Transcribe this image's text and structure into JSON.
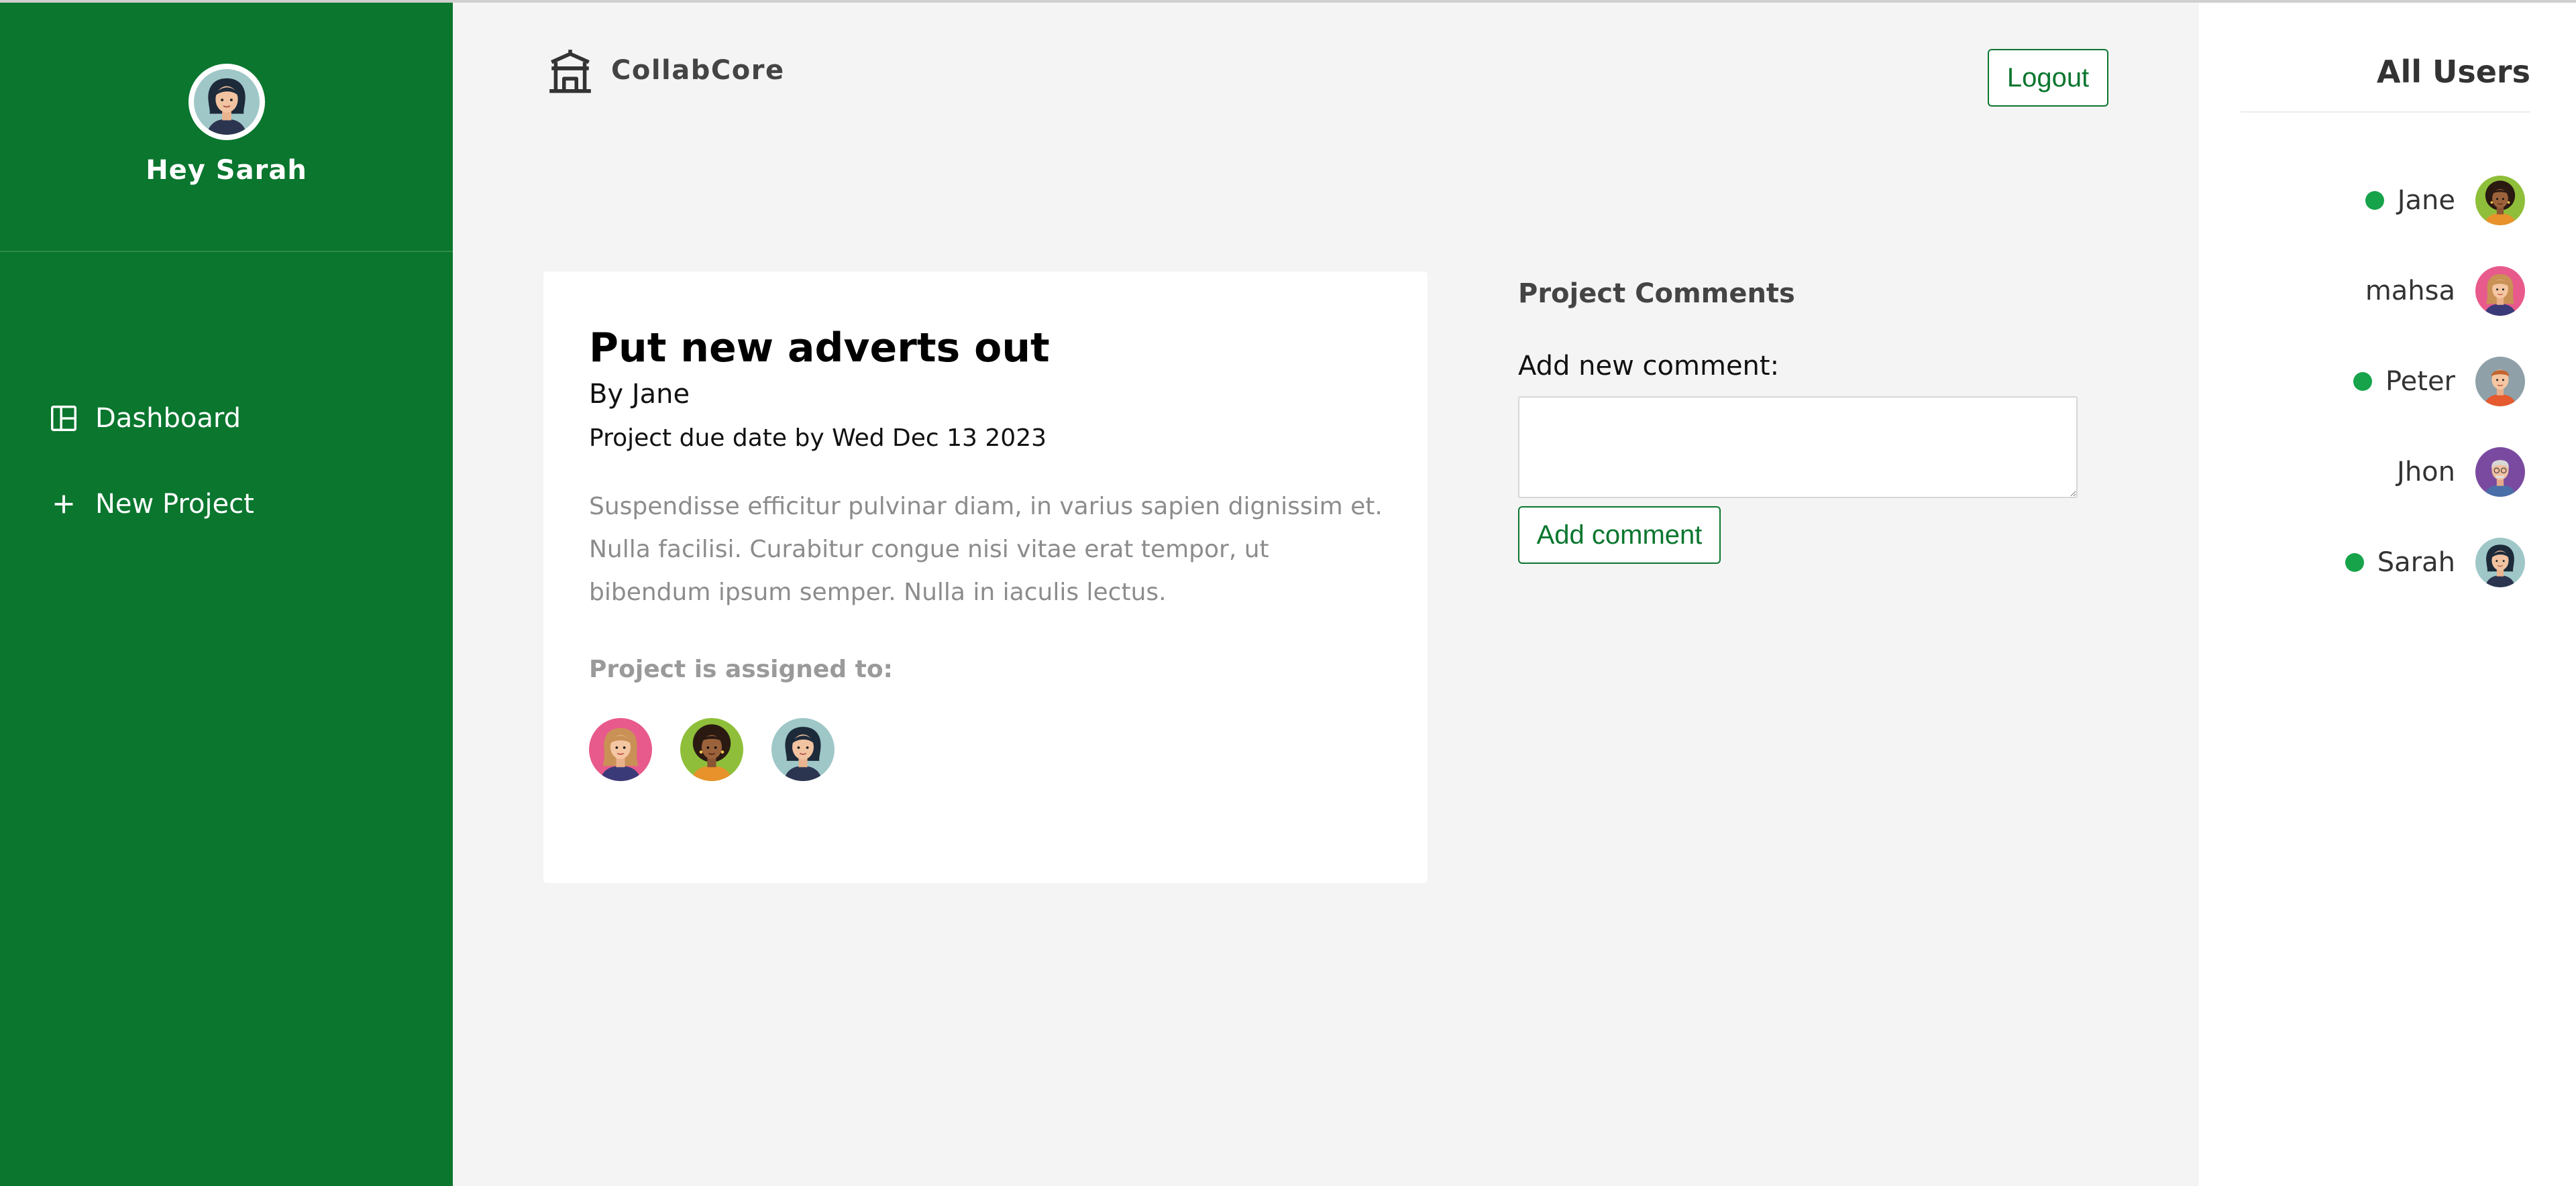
{
  "sidebar": {
    "greeting": "Hey Sarah",
    "nav": [
      {
        "label": "Dashboard",
        "icon": "dashboard-icon"
      },
      {
        "label": "New Project",
        "icon": "plus-icon"
      }
    ]
  },
  "header": {
    "brand": "CollabCore",
    "brand_icon": "temple-icon",
    "logout_label": "Logout"
  },
  "project": {
    "title": "Put new adverts out",
    "author": "By Jane",
    "due": "Project due date by Wed Dec 13 2023",
    "description": "Suspendisse efficitur pulvinar diam, in varius sapien dignissim et. Nulla facilisi. Curabitur congue nisi vitae erat tempor, ut bibendum ipsum semper. Nulla in iaculis lectus.",
    "assigned_label": "Project is assigned to:"
  },
  "comments": {
    "title": "Project Comments",
    "label": "Add new comment:",
    "input_value": "",
    "button_label": "Add comment"
  },
  "users": {
    "title": "All Users",
    "list": [
      {
        "name": "Jane",
        "online": true
      },
      {
        "name": "mahsa",
        "online": false
      },
      {
        "name": "Peter",
        "online": true
      },
      {
        "name": "Jhon",
        "online": false
      },
      {
        "name": "Sarah",
        "online": true
      }
    ]
  },
  "colors": {
    "brand_green": "#0a762e",
    "online_green": "#16a34a",
    "main_bg": "#f4f4f4"
  }
}
